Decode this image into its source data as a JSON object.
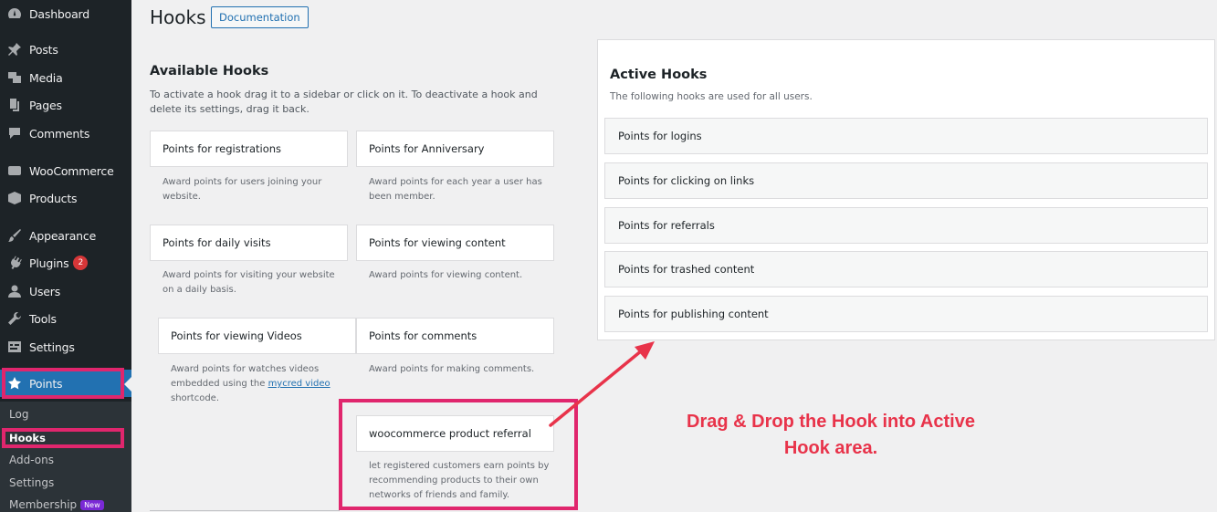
{
  "sidebar": {
    "items": [
      {
        "label": "Dashboard",
        "icon": "dashboard-icon"
      },
      {
        "label": "Posts",
        "icon": "pin-icon"
      },
      {
        "label": "Media",
        "icon": "media-icon"
      },
      {
        "label": "Pages",
        "icon": "pages-icon"
      },
      {
        "label": "Comments",
        "icon": "comment-icon"
      },
      {
        "label": "WooCommerce",
        "icon": "woo-icon"
      },
      {
        "label": "Products",
        "icon": "box-icon"
      },
      {
        "label": "Appearance",
        "icon": "brush-icon"
      },
      {
        "label": "Plugins",
        "icon": "plug-icon",
        "badge": "2"
      },
      {
        "label": "Users",
        "icon": "user-icon"
      },
      {
        "label": "Tools",
        "icon": "wrench-icon"
      },
      {
        "label": "Settings",
        "icon": "settings-icon"
      },
      {
        "label": "Points",
        "icon": "star-icon"
      }
    ],
    "submenu": [
      {
        "label": "Log"
      },
      {
        "label": "Hooks"
      },
      {
        "label": "Add-ons"
      },
      {
        "label": "Settings"
      },
      {
        "label": "Membership",
        "badge": "New"
      }
    ]
  },
  "header": {
    "title": "Hooks",
    "doc_button": "Documentation"
  },
  "available": {
    "title": "Available Hooks",
    "description": "To activate a hook drag it to a sidebar or click on it. To deactivate a hook and delete its settings, drag it back.",
    "hooks": [
      {
        "title": "Points for registrations",
        "desc": "Award points for users joining your website."
      },
      {
        "title": "Points for Anniversary",
        "desc": "Award points for each year a user has been member."
      },
      {
        "title": "Points for daily visits",
        "desc": "Award points for visiting your website on a daily basis."
      },
      {
        "title": "Points for viewing content",
        "desc": "Award points for viewing content."
      },
      {
        "title": "Points for viewing Videos",
        "desc_before": "Award points for watches videos embedded using the ",
        "desc_link": "mycred video",
        "desc_after": " shortcode."
      },
      {
        "title": "Points for comments",
        "desc": "Award points for making comments."
      },
      {
        "title": "woocommerce product referral",
        "desc": "let registered customers earn points by recommending products to their own networks of friends and family."
      }
    ]
  },
  "active": {
    "title": "Active Hooks",
    "description": "The following hooks are used for all users.",
    "hooks": [
      {
        "title": "Points for logins"
      },
      {
        "title": "Points for clicking on links"
      },
      {
        "title": "Points for referrals"
      },
      {
        "title": "Points for trashed content"
      },
      {
        "title": "Points for publishing content"
      }
    ]
  },
  "annotation": {
    "line1": "Drag & Drop the Hook into Active",
    "line2": "Hook area."
  },
  "colors": {
    "highlight": "#e0266d",
    "annotation": "#e8334a",
    "accent": "#2271b1"
  }
}
